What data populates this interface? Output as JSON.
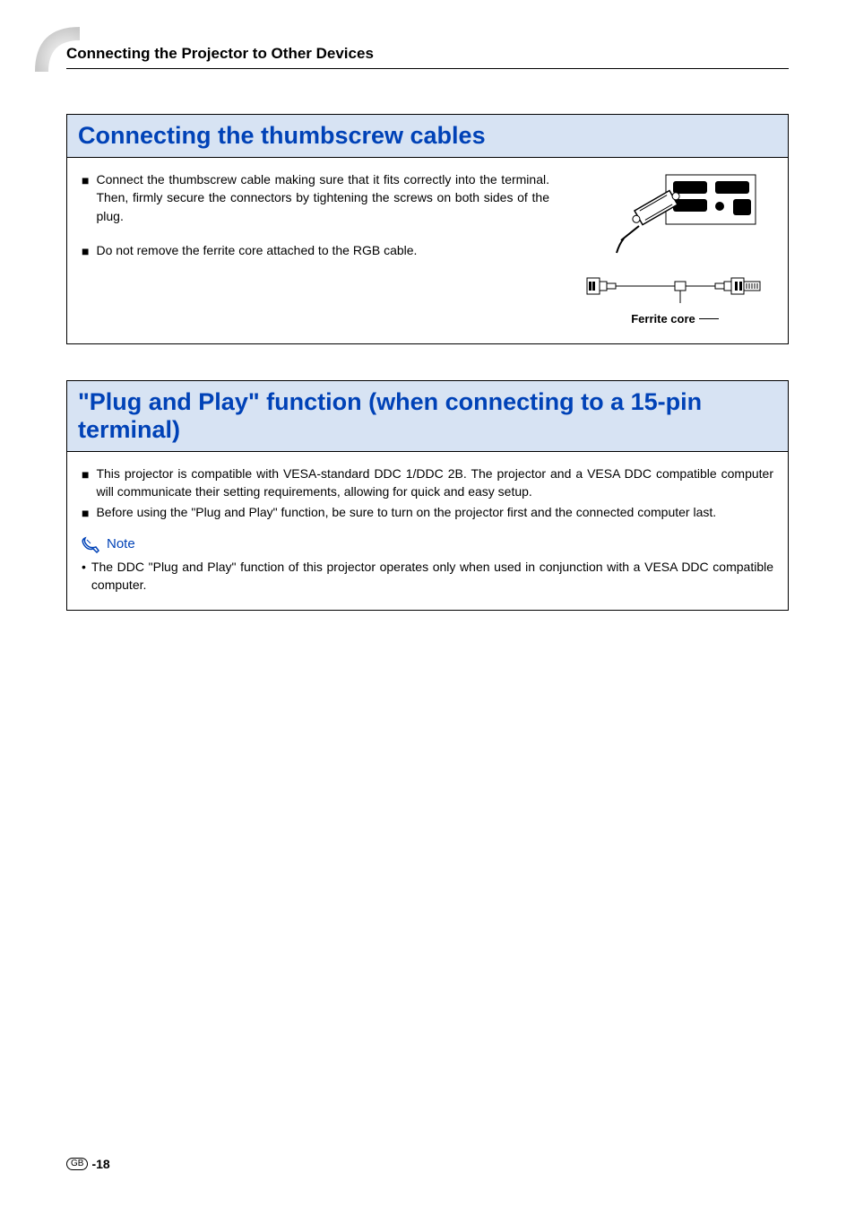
{
  "header": {
    "section_title": "Connecting the Projector to Other Devices"
  },
  "box1": {
    "title": "Connecting the thumbscrew cables",
    "bullets": [
      "Connect the thumbscrew cable making sure that it fits correctly into the terminal. Then, firmly secure the connectors by tightening the screws on both sides of the plug.",
      "Do not remove the ferrite core attached to the RGB cable."
    ],
    "diagram_caption": "Ferrite core"
  },
  "box2": {
    "title": "\"Plug and Play\" function (when connecting to a 15-pin terminal)",
    "bullets": [
      "This projector is compatible with VESA-standard DDC 1/DDC 2B. The projector and a VESA DDC compatible computer will communicate their setting requirements, allowing for quick and easy setup.",
      "Before using the \"Plug and Play\" function, be sure to turn on the projector first and the connected computer last."
    ],
    "note_label": "Note",
    "note_text": "The DDC \"Plug and Play\" function of this projector operates only when used in conjunction with a VESA DDC compatible computer."
  },
  "footer": {
    "region": "GB",
    "page": "-18"
  }
}
